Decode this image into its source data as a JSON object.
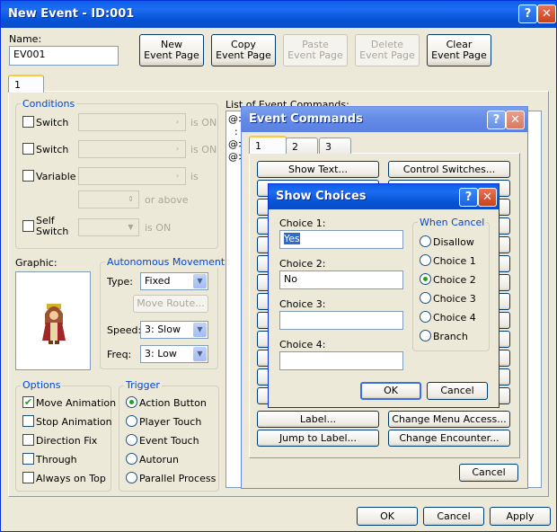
{
  "main": {
    "title": "New Event - ID:001",
    "help": "?",
    "close": "✕",
    "name_label": "Name:",
    "name_value": "EV001",
    "buttons": {
      "new": "New\nEvent Page",
      "copy": "Copy\nEvent Page",
      "paste": "Paste\nEvent Page",
      "delete": "Delete\nEvent Page",
      "clear": "Clear\nEvent Page"
    },
    "page_tab": "1",
    "conditions": {
      "title": "Conditions",
      "switch1": "Switch",
      "switch2": "Switch",
      "variable": "Variable",
      "self_switch": "Self\nSwitch",
      "is_on": "is ON",
      "is": "is",
      "or_above": "or above"
    },
    "graphic_label": "Graphic:",
    "auto": {
      "title": "Autonomous Movement",
      "type_label": "Type:",
      "type_value": "Fixed",
      "move_route": "Move Route...",
      "speed_label": "Speed:",
      "speed_value": "3: Slow",
      "freq_label": "Freq:",
      "freq_value": "3: Low"
    },
    "list_label": "List of Event Commands:",
    "list_rows": [
      "@>",
      "  :",
      "@>",
      "@>"
    ],
    "options": {
      "title": "Options",
      "items": [
        "Move Animation",
        "Stop Animation",
        "Direction Fix",
        "Through",
        "Always on Top"
      ]
    },
    "trigger": {
      "title": "Trigger",
      "items": [
        "Action Button",
        "Player Touch",
        "Event Touch",
        "Autorun",
        "Parallel Process"
      ]
    },
    "ok": "OK",
    "cancel": "Cancel",
    "apply": "Apply"
  },
  "commands": {
    "title": "Event Commands",
    "tabs": [
      "1",
      "2",
      "3"
    ],
    "buttons": [
      "Show Text...",
      "Control Switches...",
      "Label...",
      "Change Menu Access...",
      "Jump to Label...",
      "Change Encounter..."
    ],
    "cancel": "Cancel"
  },
  "choices": {
    "title": "Show Choices",
    "c1_label": "Choice 1:",
    "c1": "Yes",
    "c2_label": "Choice 2:",
    "c2": "No",
    "c3_label": "Choice 3:",
    "c3": "",
    "c4_label": "Choice 4:",
    "c4": "",
    "when_cancel": "When Cancel",
    "options": [
      "Disallow",
      "Choice 1",
      "Choice 2",
      "Choice 3",
      "Choice 4",
      "Branch"
    ],
    "selected": "Choice 2",
    "ok": "OK",
    "cancel": "Cancel"
  },
  "checked_options": [
    "Move Animation"
  ],
  "selected_trigger": "Action Button"
}
